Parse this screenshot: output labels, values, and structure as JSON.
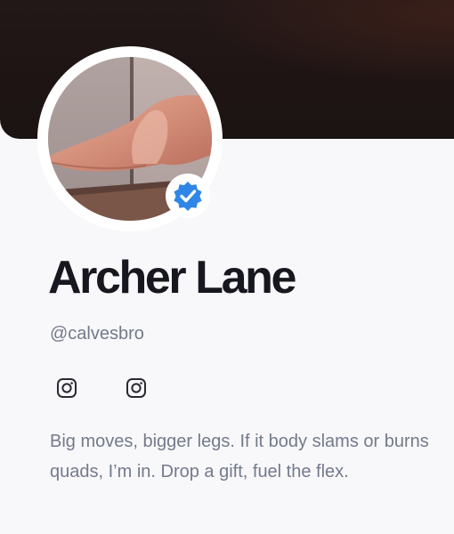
{
  "profile": {
    "name": "Archer Lane",
    "handle": "@calvesbro",
    "verified": true,
    "bio": "Big moves, bigger legs. If it body slams or burns quads, I’m in. Drop a gift, fuel the flex."
  },
  "social_links": [
    {
      "icon": "instagram-icon"
    },
    {
      "icon": "instagram-icon"
    }
  ],
  "colors": {
    "name_text": "#17171f",
    "muted_text": "#737a8c",
    "verified_badge": "#2f86e6",
    "page_background": "#f8f8fa"
  }
}
